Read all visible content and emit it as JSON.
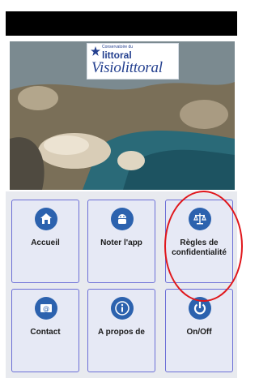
{
  "logo": {
    "small_text": "Conservatoire du",
    "brand": "littoral",
    "app_name": "Visiolittoral"
  },
  "menu": [
    {
      "label": "Accueil",
      "icon": "home-icon"
    },
    {
      "label": "Noter l'app",
      "icon": "android-icon"
    },
    {
      "label": "Règles de confidentialité",
      "icon": "scales-icon"
    },
    {
      "label": "Contact",
      "icon": "email-icon"
    },
    {
      "label": "A propos de",
      "icon": "info-icon"
    },
    {
      "label": "On/Off",
      "icon": "power-icon"
    }
  ],
  "colors": {
    "icon_circle": "#2c62ae",
    "tile_bg": "#e6e9f5",
    "tile_border": "#6c6fd6",
    "highlight": "#e0161b"
  }
}
